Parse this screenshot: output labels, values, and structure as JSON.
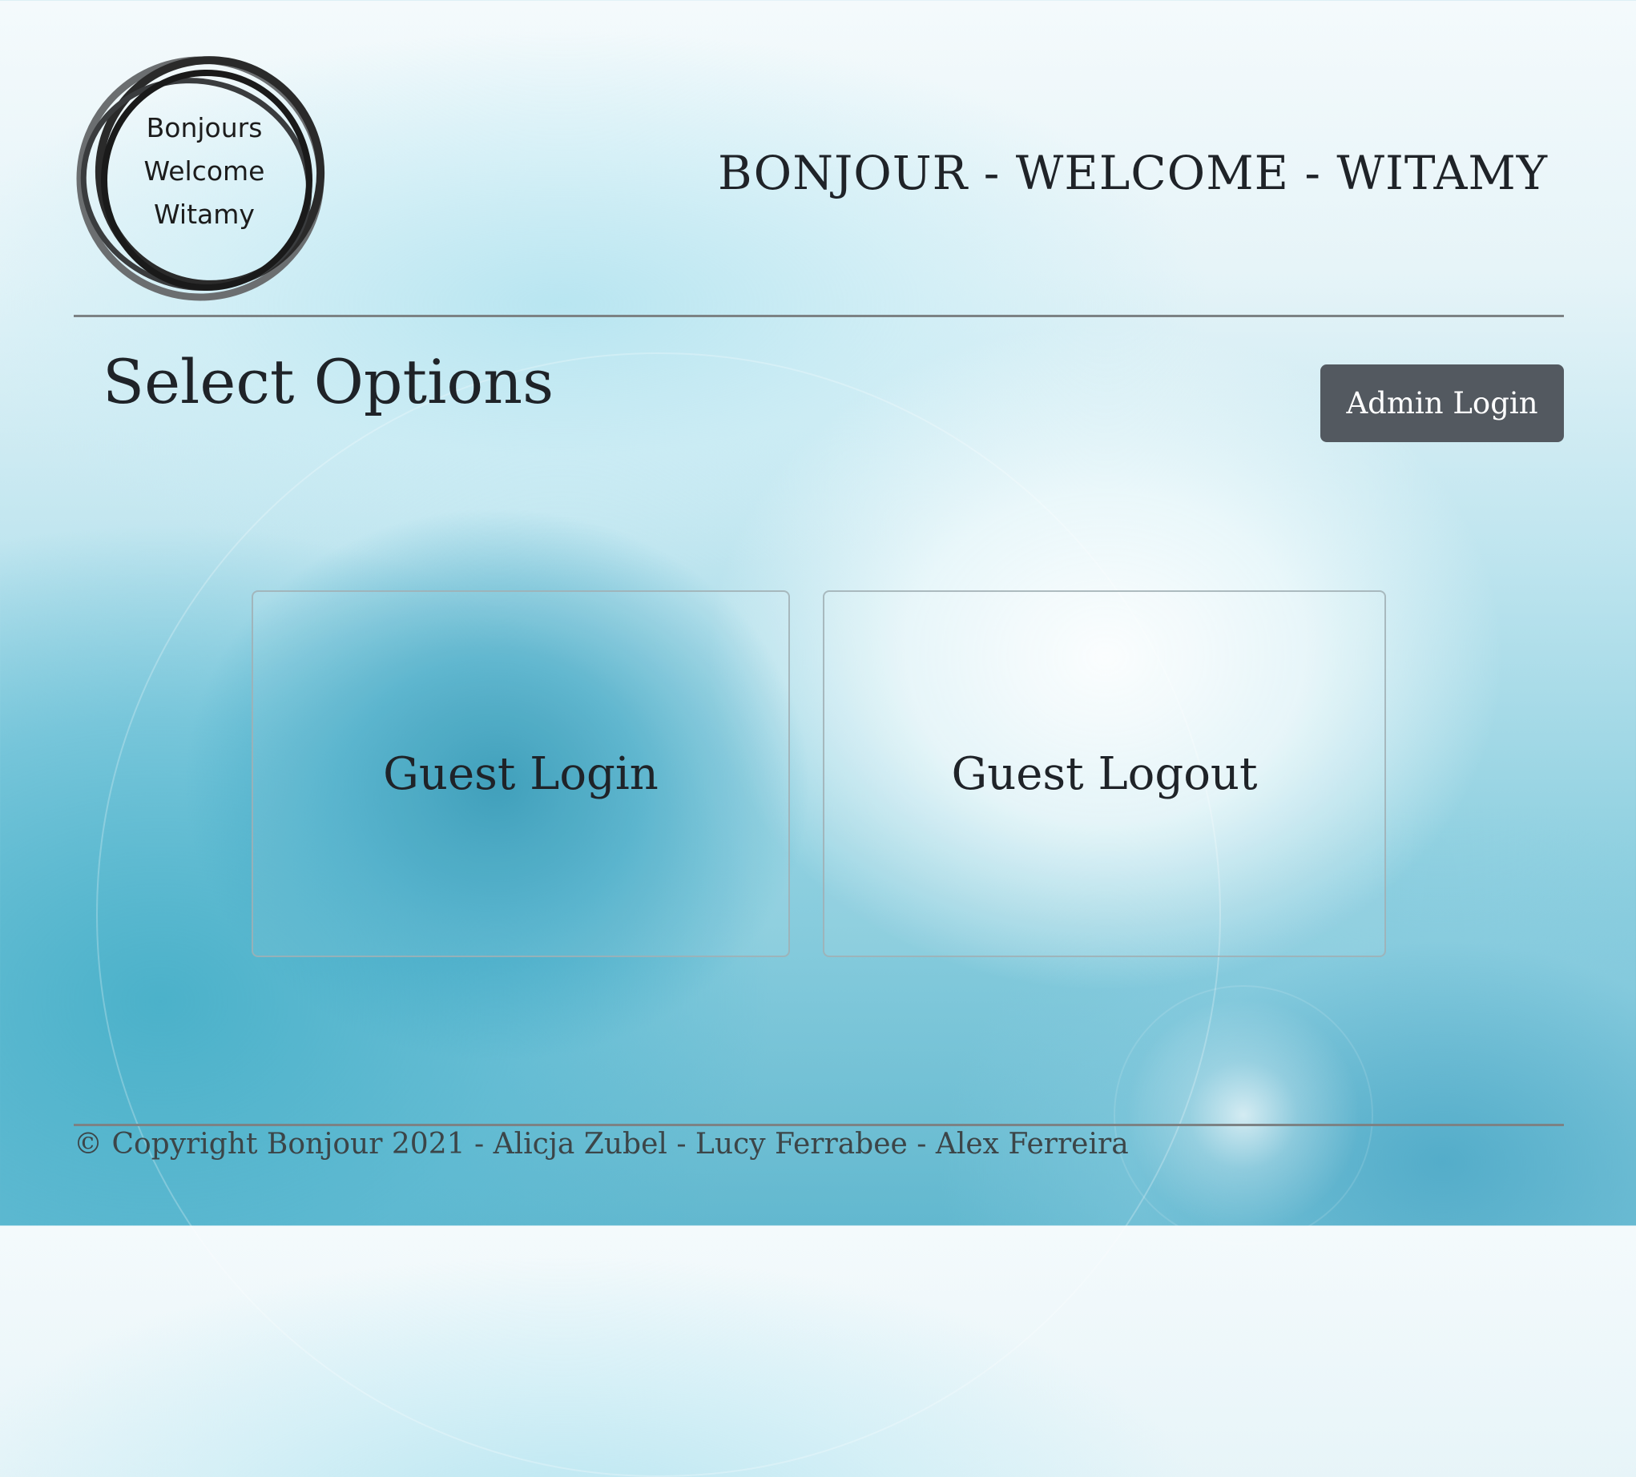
{
  "logo": {
    "lines": [
      "Bonjours",
      "Welcome",
      "Witamy"
    ]
  },
  "header": {
    "title": "BONJOUR - WELCOME - WITAMY"
  },
  "main": {
    "section_title": "Select Options",
    "admin_button": "Admin Login",
    "cards": [
      {
        "label": "Guest Login"
      },
      {
        "label": "Guest Logout"
      }
    ]
  },
  "footer": {
    "text": "© Copyright Bonjour 2021 - Alicja Zubel - Lucy Ferrabee - Alex Ferreira"
  },
  "colors": {
    "button_bg": "#535960",
    "text": "#1f2328",
    "rule": "#7c8284"
  }
}
